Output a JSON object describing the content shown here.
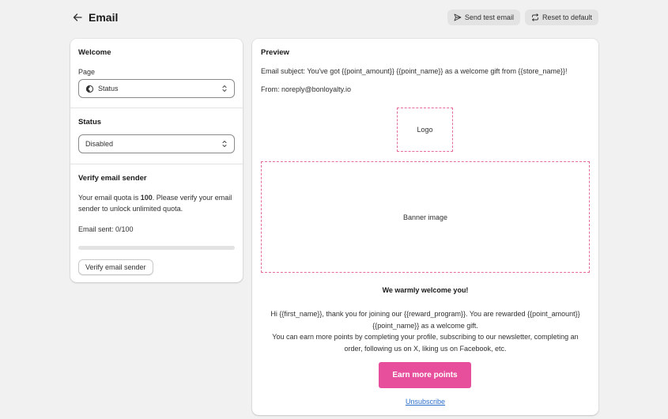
{
  "header": {
    "title": "Email",
    "send_test_label": "Send test email",
    "reset_label": "Reset to default"
  },
  "welcome": {
    "title": "Welcome",
    "page_label": "Page",
    "page_value": "Status"
  },
  "status": {
    "title": "Status",
    "value": "Disabled"
  },
  "verify": {
    "title": "Verify email sender",
    "quota_prefix": "Your email quota is ",
    "quota_value": "100",
    "quota_suffix": ". Please verify your email sender to unlock unlimited quota.",
    "sent_text": "Email sent: 0/100",
    "sent_fraction": 0,
    "button_label": "Verify email sender"
  },
  "preview": {
    "title": "Preview",
    "subject": "Email subject: You've got {{point_amount}} {{point_name}} as a welcome gift from {{store_name}}!",
    "from": "From: noreply@bonloyalty.io",
    "logo_label": "Logo",
    "banner_label": "Banner image",
    "heading": "We warmly welcome you!",
    "body_line1": "Hi {{first_name}}, thank you for joining our {{reward_program}}. You are rewarded {{point_amount}} {{point_name}} as a welcome gift.",
    "body_line2": "You can earn more points by completing your profile, subscribing to our newsletter, completing an order, following us on X, liking us on Facebook, etc.",
    "cta_label": "Earn more points",
    "unsubscribe_label": "Unsubscribe",
    "accent_color": "#e74f9c",
    "placeholder_border_color": "#e56b9c"
  }
}
